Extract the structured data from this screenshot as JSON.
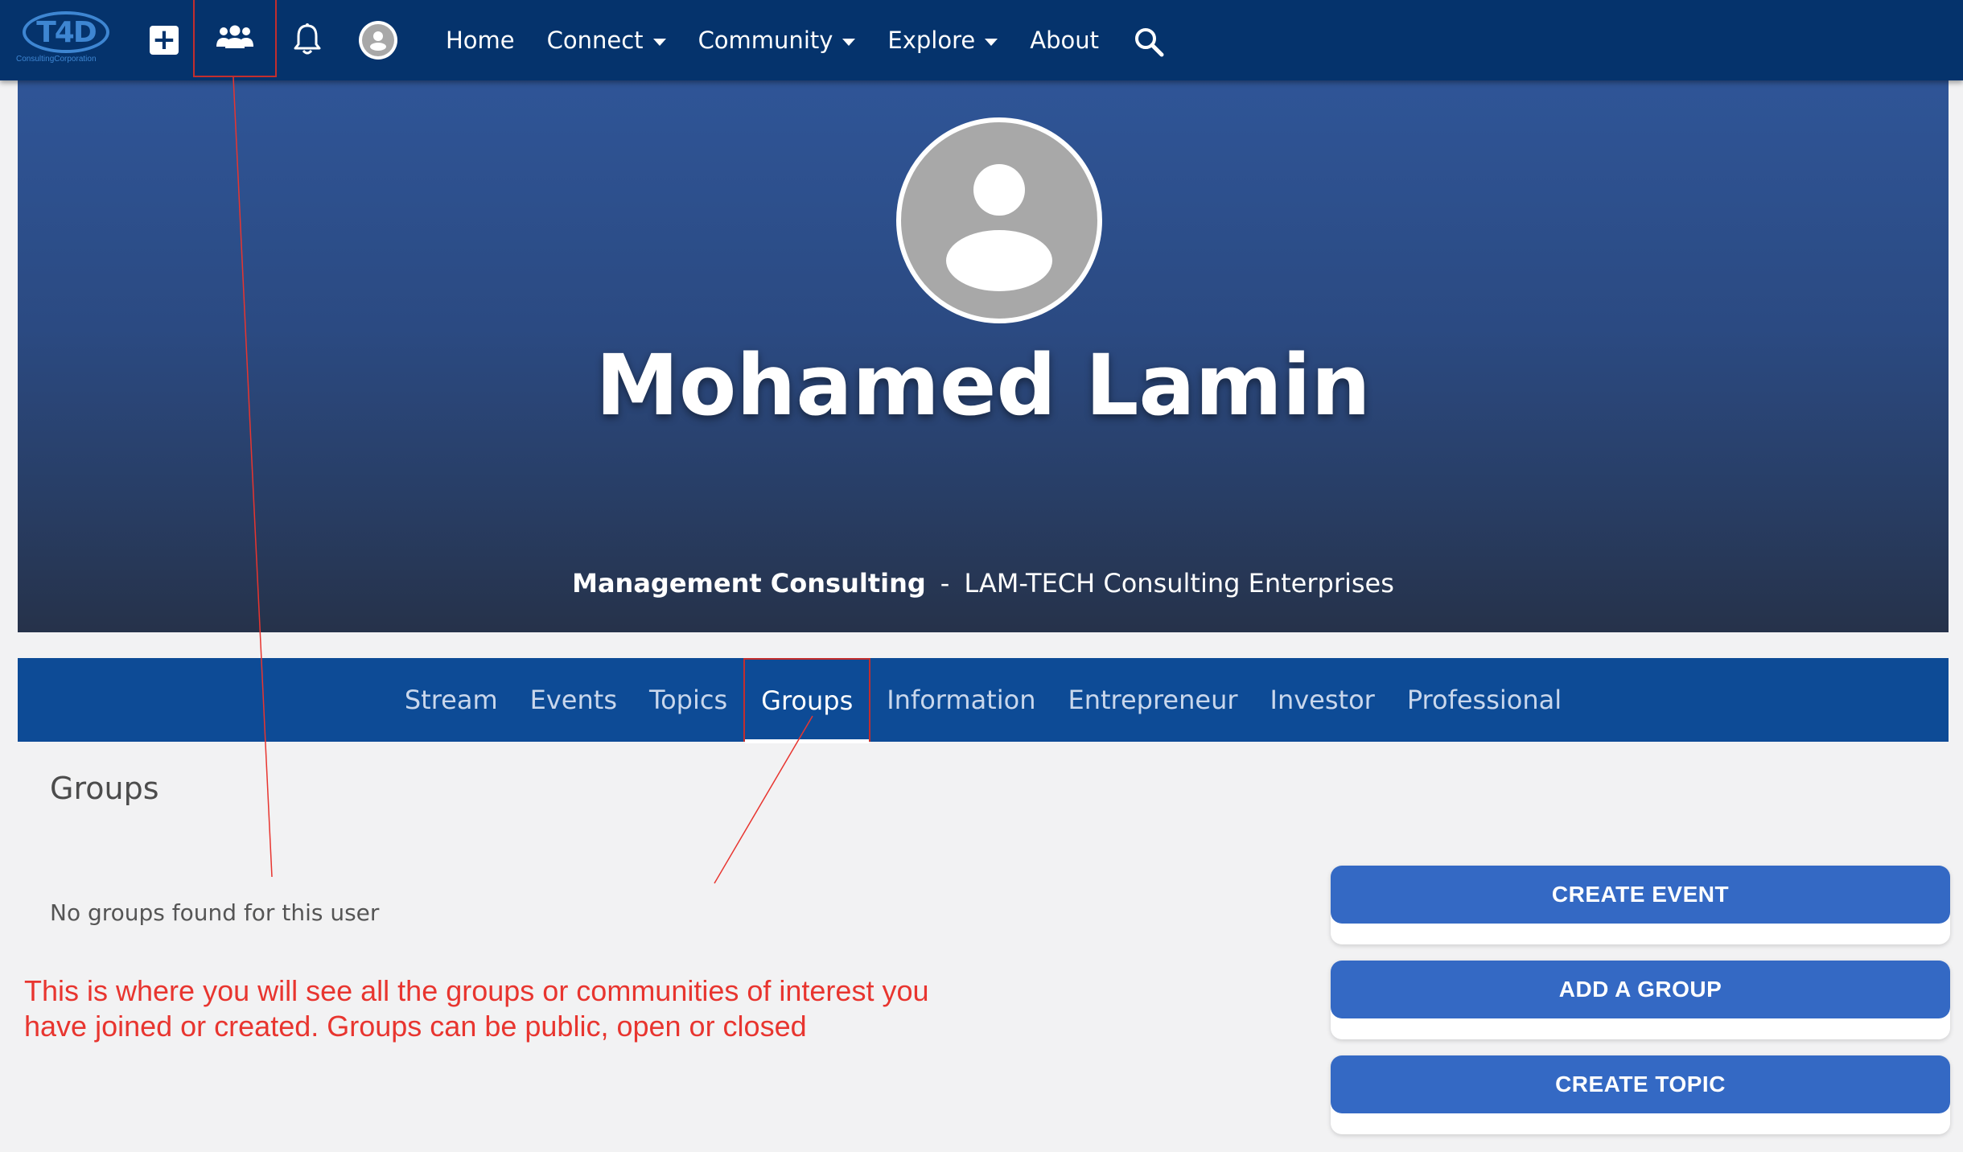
{
  "brand": {
    "logo_text": "T4D",
    "logo_subtitle": "ConsultingCorporation"
  },
  "nav": {
    "icons": [
      "plus-square-icon",
      "groups-icon",
      "bell-icon",
      "user-avatar-icon",
      "search-icon"
    ],
    "links": [
      {
        "label": "Home",
        "dropdown": false
      },
      {
        "label": "Connect",
        "dropdown": true
      },
      {
        "label": "Community",
        "dropdown": true
      },
      {
        "label": "Explore",
        "dropdown": true
      },
      {
        "label": "About",
        "dropdown": false
      }
    ]
  },
  "profile": {
    "name": "Mohamed Lamin",
    "role": "Management Consulting",
    "separator": "-",
    "company": "LAM-TECH Consulting Enterprises"
  },
  "tabs": [
    {
      "label": "Stream",
      "active": false
    },
    {
      "label": "Events",
      "active": false
    },
    {
      "label": "Topics",
      "active": false
    },
    {
      "label": "Groups",
      "active": true
    },
    {
      "label": "Information",
      "active": false
    },
    {
      "label": "Entrepreneur",
      "active": false
    },
    {
      "label": "Investor",
      "active": false
    },
    {
      "label": "Professional",
      "active": false
    }
  ],
  "content": {
    "heading": "Groups",
    "empty_message": "No groups found for this user"
  },
  "annotation": {
    "line1": "This is where you will see all the groups or communities of interest you",
    "line2": "have joined or created. Groups can be public, open or closed"
  },
  "actions": {
    "create_event": "CREATE EVENT",
    "add_group": "ADD A GROUP",
    "create_topic": "CREATE TOPIC"
  },
  "colors": {
    "navbar": "#05336c",
    "tabbar": "#0d4b96",
    "button": "#3469c4",
    "annotation": "#e8352f"
  }
}
